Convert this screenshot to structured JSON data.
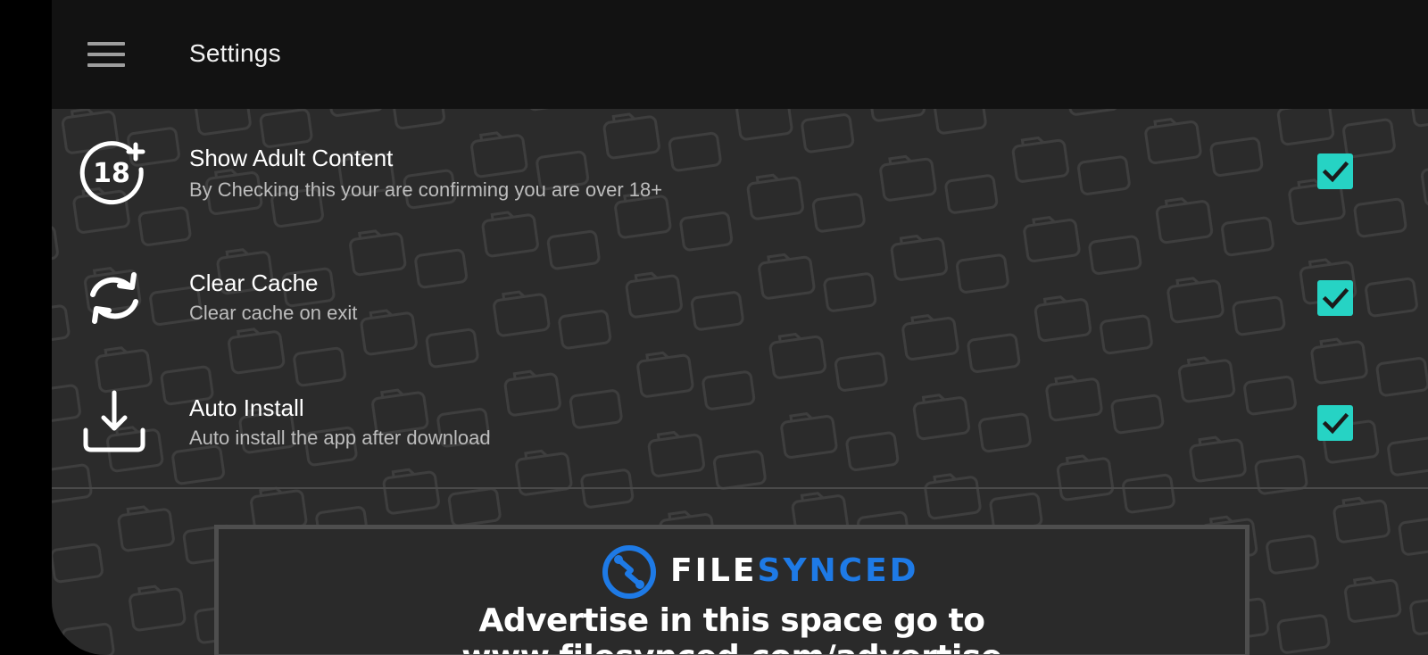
{
  "app_bar": {
    "title": "Settings",
    "menu_icon": "hamburger-menu-icon"
  },
  "settings": [
    {
      "icon": "eighteen-plus-icon",
      "icon_text": "18",
      "title": "Show Adult Content",
      "subtitle": "By Checking this your are confirming you are over 18+",
      "checked": true
    },
    {
      "icon": "refresh-icon",
      "title": "Clear Cache",
      "subtitle": "Clear cache on exit",
      "checked": true
    },
    {
      "icon": "download-icon",
      "title": "Auto Install",
      "subtitle": "Auto install the app after download",
      "checked": true
    }
  ],
  "ad": {
    "logo_icon": "filesynced-logo-icon",
    "brand_part1": "FILE",
    "brand_part2": "SYNCED",
    "text": "Advertise in this space go to www.filesynced.com/advertise"
  },
  "colors": {
    "checkbox_accent": "#26d3c4",
    "brand_blue": "#1e7ae6",
    "app_bar": "#121212",
    "background": "#2b2b2b"
  }
}
